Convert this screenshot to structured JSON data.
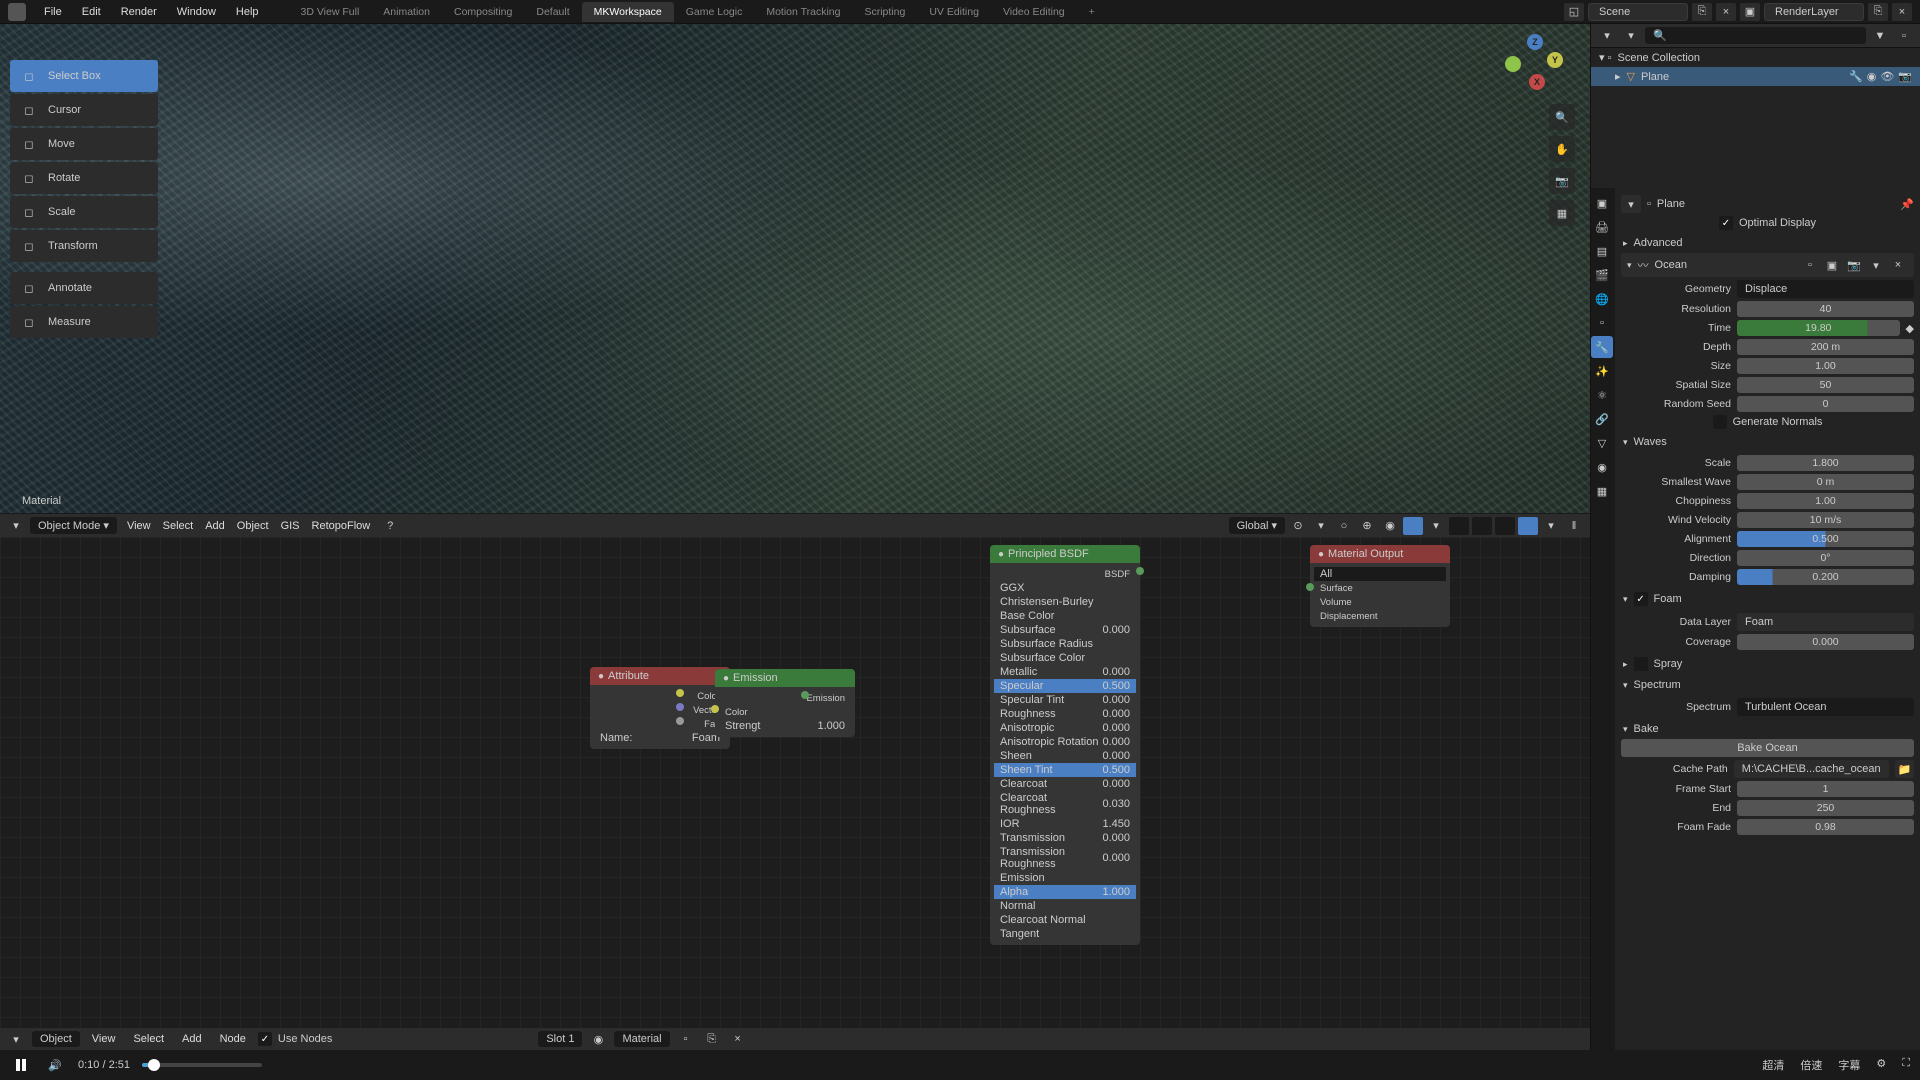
{
  "topmenu": {
    "file": "File",
    "edit": "Edit",
    "render": "Render",
    "window": "Window",
    "help": "Help"
  },
  "workspaces": {
    "tabs": [
      "3D View Full",
      "Animation",
      "Compositing",
      "Default",
      "MKWorkspace",
      "Game Logic",
      "Motion Tracking",
      "Scripting",
      "UV Editing",
      "Video Editing"
    ],
    "active_index": 4
  },
  "topright": {
    "scene": "Scene",
    "renderlayer": "RenderLayer"
  },
  "tools": [
    {
      "label": "Select Box",
      "icon": "select"
    },
    {
      "label": "Cursor",
      "icon": "cursor"
    },
    {
      "label": "Move",
      "icon": "move"
    },
    {
      "label": "Rotate",
      "icon": "rotate"
    },
    {
      "label": "Scale",
      "icon": "scale"
    },
    {
      "label": "Transform",
      "icon": "transform"
    },
    {
      "label": "Annotate",
      "icon": "pen"
    },
    {
      "label": "Measure",
      "icon": "ruler"
    }
  ],
  "viewport_header": {
    "mode": "Object Mode",
    "menus": [
      "View",
      "Select",
      "Add",
      "Object",
      "GIS",
      "RetopoFlow"
    ],
    "orientation": "Global"
  },
  "viewport_label": "Material",
  "gizmo": {
    "x": "X",
    "y": "Y",
    "z": "Z"
  },
  "outliner": {
    "scene_collection": "Scene Collection",
    "items": [
      {
        "name": "Plane",
        "selected": true
      }
    ]
  },
  "props_header": {
    "object": "Plane"
  },
  "optimal_display": "Optimal Display",
  "sections": {
    "advanced": "Advanced",
    "ocean": "Ocean",
    "waves": "Waves",
    "foam": "Foam",
    "spray": "Spray",
    "spectrum": "Spectrum",
    "bake": "Bake"
  },
  "ocean": {
    "geometry": {
      "label": "Geometry",
      "value": "Displace"
    },
    "resolution": {
      "label": "Resolution",
      "value": "40"
    },
    "time": {
      "label": "Time",
      "value": "19.80"
    },
    "depth": {
      "label": "Depth",
      "value": "200 m"
    },
    "size": {
      "label": "Size",
      "value": "1.00"
    },
    "spatial_size": {
      "label": "Spatial Size",
      "value": "50"
    },
    "random_seed": {
      "label": "Random Seed",
      "value": "0"
    },
    "gen_normals": "Generate Normals"
  },
  "waves": {
    "scale": {
      "label": "Scale",
      "value": "1.800"
    },
    "smallest": {
      "label": "Smallest Wave",
      "value": "0 m"
    },
    "choppiness": {
      "label": "Choppiness",
      "value": "1.00"
    },
    "wind": {
      "label": "Wind Velocity",
      "value": "10 m/s"
    },
    "alignment": {
      "label": "Alignment",
      "value": "0.500"
    },
    "direction": {
      "label": "Direction",
      "value": "0°"
    },
    "damping": {
      "label": "Damping",
      "value": "0.200"
    }
  },
  "foam": {
    "enabled": true,
    "data_layer": {
      "label": "Data Layer",
      "value": "Foam"
    },
    "coverage": {
      "label": "Coverage",
      "value": "0.000"
    }
  },
  "spectrum": {
    "label": "Spectrum",
    "value": "Turbulent Ocean"
  },
  "bake": {
    "button": "Bake Ocean",
    "cache_path": {
      "label": "Cache Path",
      "value": "M:\\CACHE\\B...cache_ocean"
    },
    "frame_start": {
      "label": "Frame Start",
      "value": "1"
    },
    "end": {
      "label": "End",
      "value": "250"
    },
    "foam_fade": {
      "label": "Foam Fade",
      "value": "0.98"
    }
  },
  "nodes": {
    "attribute": {
      "title": "Attribute",
      "outputs": [
        "Color",
        "Vector",
        "Fac"
      ],
      "name_label": "Name:",
      "name_value": "Foam"
    },
    "emission": {
      "title": "Emission",
      "out": "Emission",
      "color": "Color",
      "strength": "Strengt",
      "strength_val": "1.000"
    },
    "bsdf": {
      "title": "Principled BSDF",
      "out": "BSDF",
      "rows": [
        {
          "l": "GGX",
          "v": ""
        },
        {
          "l": "Christensen-Burley",
          "v": ""
        },
        {
          "l": "Base Color",
          "v": ""
        },
        {
          "l": "Subsurface",
          "v": "0.000"
        },
        {
          "l": "Subsurface Radius",
          "v": ""
        },
        {
          "l": "Subsurface Color",
          "v": ""
        },
        {
          "l": "Metallic",
          "v": "0.000"
        },
        {
          "l": "Specular",
          "v": "0.500",
          "sel": true
        },
        {
          "l": "Specular Tint",
          "v": "0.000"
        },
        {
          "l": "Roughness",
          "v": "0.000"
        },
        {
          "l": "Anisotropic",
          "v": "0.000"
        },
        {
          "l": "Anisotropic Rotation",
          "v": "0.000"
        },
        {
          "l": "Sheen",
          "v": "0.000"
        },
        {
          "l": "Sheen Tint",
          "v": "0.500",
          "sel": true
        },
        {
          "l": "Clearcoat",
          "v": "0.000"
        },
        {
          "l": "Clearcoat Roughness",
          "v": "0.030"
        },
        {
          "l": "IOR",
          "v": "1.450"
        },
        {
          "l": "Transmission",
          "v": "0.000"
        },
        {
          "l": "Transmission Roughness",
          "v": "0.000"
        },
        {
          "l": "Emission",
          "v": ""
        },
        {
          "l": "Alpha",
          "v": "1.000",
          "sel": true
        },
        {
          "l": "Normal",
          "v": ""
        },
        {
          "l": "Clearcoat Normal",
          "v": ""
        },
        {
          "l": "Tangent",
          "v": ""
        }
      ]
    },
    "matout": {
      "title": "Material Output",
      "all": "All",
      "rows": [
        "Surface",
        "Volume",
        "Displacement"
      ]
    }
  },
  "node_editor_header": {
    "menus": [
      "View",
      "Select",
      "Add",
      "Node"
    ],
    "use_nodes": "Use Nodes",
    "slot": "Slot 1",
    "material": "Material",
    "object": "Object"
  },
  "player": {
    "time": "0:10 / 2:51",
    "quality": "超清",
    "speed": "倍速",
    "subtitle": "字幕"
  }
}
